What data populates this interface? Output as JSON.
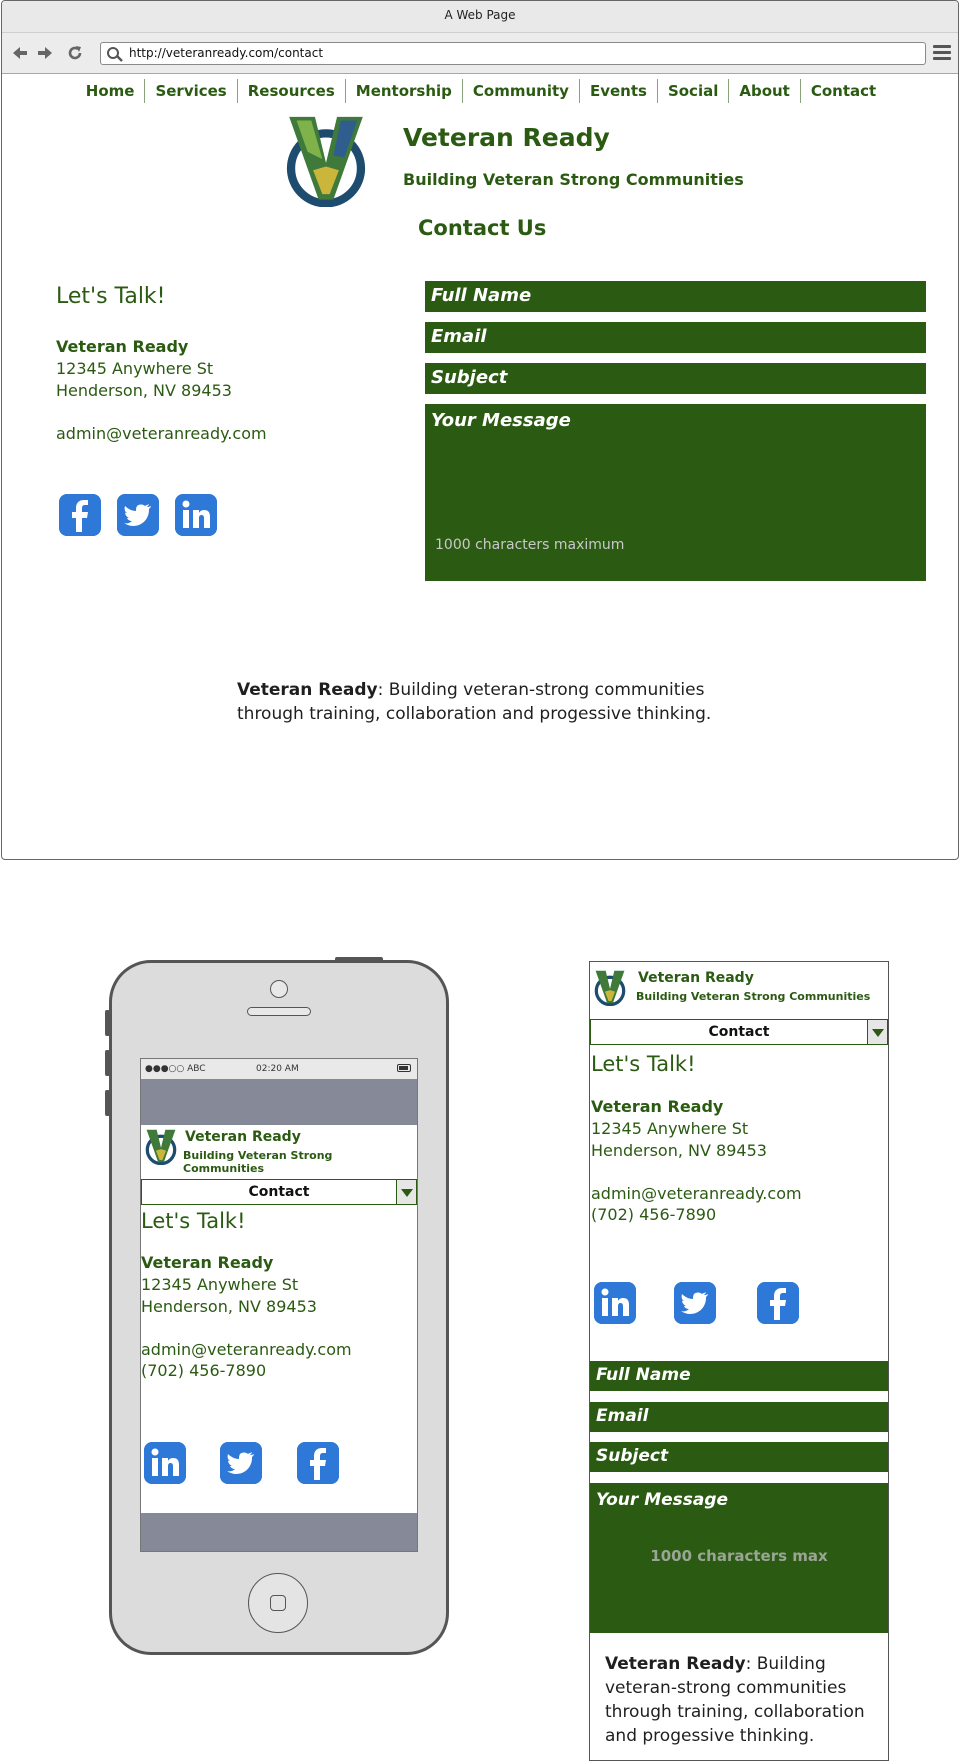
{
  "browser": {
    "window_title": "A Web Page",
    "url": "http://veteranready.com/contact"
  },
  "nav": {
    "items": [
      "Home",
      "Services",
      "Resources",
      "Mentorship",
      "Community",
      "Events",
      "Social",
      "About",
      "Contact"
    ]
  },
  "brand": {
    "title": "Veteran Ready",
    "subtitle": "Building Veteran Strong Communities"
  },
  "page": {
    "heading": "Contact Us"
  },
  "contact": {
    "lets_talk": "Let's Talk!",
    "name": "Veteran Ready",
    "street": "12345 Anywhere St",
    "city": "Henderson, NV 89453",
    "email": "admin@veteranready.com",
    "phone": "(702) 456-7890"
  },
  "social": {
    "facebook": "f",
    "twitter": "twitter",
    "linkedin": "in"
  },
  "form": {
    "full_name": "Full Name",
    "email": "Email",
    "subject": "Subject",
    "message": "Your Message",
    "message_note": "1000 characters maximum",
    "message_note_short": "1000 characters max"
  },
  "footer": {
    "brand": "Veteran Ready",
    "text": ": Building veteran-strong communities through training, collaboration and progessive thinking."
  },
  "mobile": {
    "status_signal": "●●●○○ ABC",
    "status_time": "02:20 AM",
    "dropdown_selected": "Contact"
  },
  "colors": {
    "brand_green": "#2b5a12",
    "social_blue": "#2e79d8",
    "phone_band": "#868a98"
  }
}
